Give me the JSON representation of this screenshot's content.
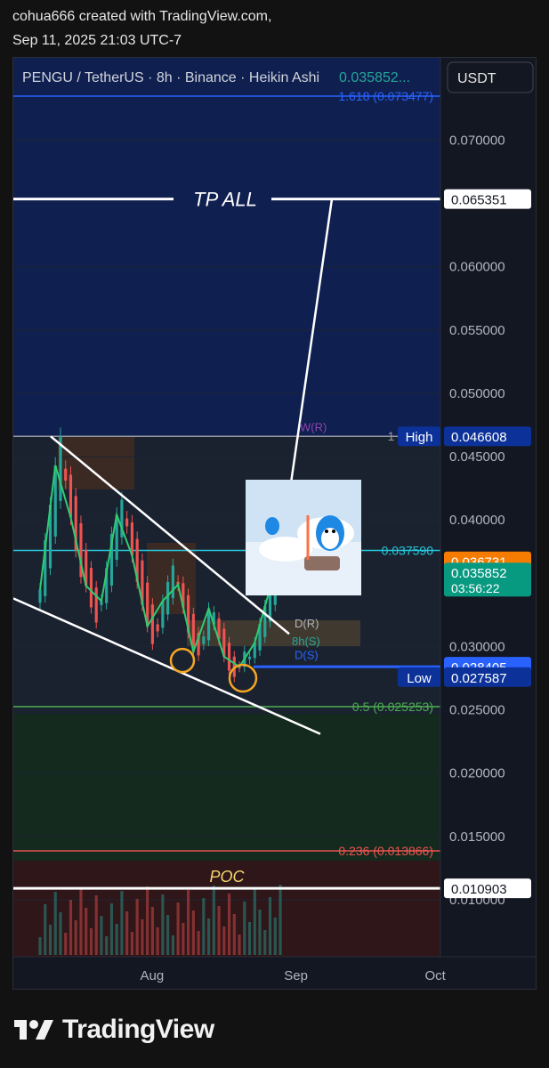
{
  "header": {
    "line1": "cohua666 created with TradingView.com,",
    "line2": "Sep 11, 2025 21:03 UTC-7"
  },
  "brand": {
    "name": "TradingView"
  },
  "colors": {
    "bg": "#131722",
    "up": "#26a69a",
    "down": "#ef5350",
    "label_bg": "#0c3299",
    "white": "#ffffff",
    "current": "#f7525f",
    "last": "#089981"
  },
  "chart_data": {
    "type": "candlestick",
    "symbol_line": "PENGU / TetherUS · 8h · Binance · Heikin Ashi",
    "symbol_price": "0.035852...",
    "currency": "USDT",
    "yaxis": {
      "min": 0.0055,
      "max": 0.0765,
      "ticks": [
        0.07,
        0.06,
        0.055,
        0.05,
        0.045,
        0.04,
        0.03,
        0.025,
        0.02,
        0.015,
        0.01
      ],
      "ticks_label": [
        "0.070000",
        "0.060000",
        "0.055000",
        "0.050000",
        "0.045000",
        "0.040000",
        "0.030000",
        "0.025000",
        "0.020000",
        "0.015000",
        "0.010000"
      ]
    },
    "xaxis": {
      "labels": [
        {
          "text": "Aug",
          "x": "2025-08-01"
        },
        {
          "text": "Sep",
          "x": "2025-09-01"
        },
        {
          "text": "Oct",
          "x": "2025-10-01"
        }
      ],
      "range": [
        "2025-07-05",
        "2025-10-05"
      ]
    },
    "price_labels": [
      {
        "value": 0.065351,
        "text": "0.065351",
        "style": "white"
      },
      {
        "value": 0.046608,
        "text": "0.046608",
        "style": "blue",
        "tag": "High"
      },
      {
        "value": 0.036731,
        "text": "0.036731",
        "style": "orange"
      },
      {
        "value": 0.035852,
        "text": "0.035852",
        "style": "green",
        "sub": "03:56:22"
      },
      {
        "value": 0.028405,
        "text": "0.028405",
        "style": "bright"
      },
      {
        "value": 0.027587,
        "text": "0.027587",
        "style": "blue",
        "tag": "Low"
      },
      {
        "value": 0.010903,
        "text": "0.010903",
        "style": "white"
      }
    ],
    "fib_levels": [
      {
        "value": 0.073477,
        "text": "1.618 (0.073477)",
        "color": "#2962ff"
      },
      {
        "value": 0.046608,
        "text": "1 (0.046",
        "color": "#9598a1"
      },
      {
        "value": 0.03759,
        "text": "0.037590",
        "color": "#26c6da"
      },
      {
        "value": 0.025253,
        "text": "0.5 (0.025253)",
        "color": "#4caf50"
      },
      {
        "value": 0.013866,
        "text": "0.236 (0.013866)",
        "color": "#ef5350"
      }
    ],
    "annotations": {
      "tp": "TP ALL",
      "tp_value": 0.065351,
      "poc": "POC",
      "poc_value": 0.010903,
      "wr": "W(R)",
      "dr": "D(R)",
      "ds": "D(S)",
      "h8": "8h(S)"
    },
    "series_close": [
      0.0345,
      0.0384,
      0.0412,
      0.0443,
      0.0466,
      0.0431,
      0.0402,
      0.0376,
      0.0355,
      0.0348,
      0.0331,
      0.0319,
      0.0336,
      0.0362,
      0.0389,
      0.0404,
      0.0416,
      0.0395,
      0.0372,
      0.0351,
      0.0333,
      0.0316,
      0.0302,
      0.0312,
      0.0336,
      0.0351,
      0.0364,
      0.0349,
      0.0331,
      0.0311,
      0.0296,
      0.0293,
      0.0308,
      0.033,
      0.0327,
      0.0306,
      0.0292,
      0.0281,
      0.0276,
      0.0284,
      0.0296,
      0.0292,
      0.0303,
      0.0318,
      0.0332,
      0.0346,
      0.0359,
      0.0358
    ]
  }
}
